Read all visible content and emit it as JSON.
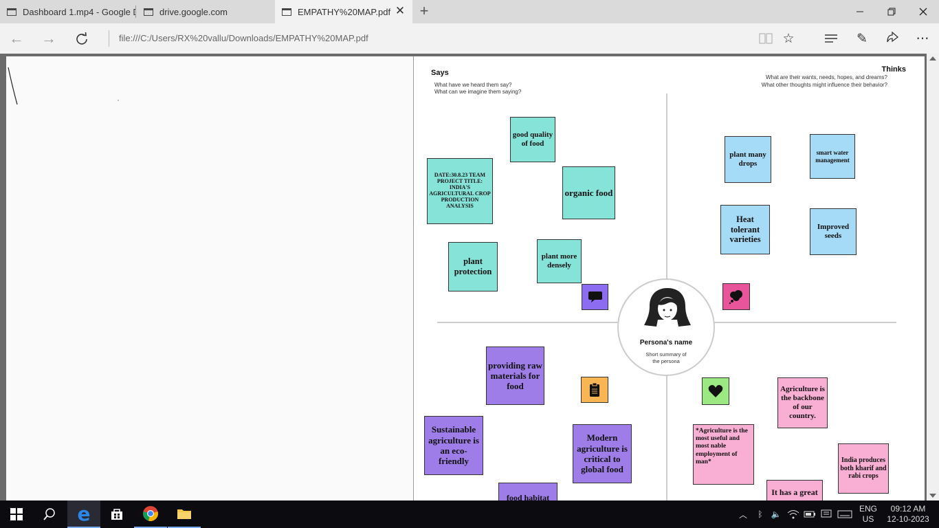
{
  "browser": {
    "tabs": [
      {
        "label": "Dashboard 1.mp4 - Google D",
        "icon": "tab-page-icon"
      },
      {
        "label": "drive.google.com",
        "icon": "tab-page-icon"
      },
      {
        "label": "EMPATHY%20MAP.pdf",
        "icon": "tab-page-icon"
      }
    ],
    "address": "file:///C:/Users/RX%20vallu/Downloads/EMPATHY%20MAP.pdf"
  },
  "empathy_map": {
    "says": {
      "title": "Says",
      "q1": "What have we heard them say?",
      "q2": "What can we imagine them saying?"
    },
    "thinks": {
      "title": "Thinks",
      "q1": "What are their wants, needs, hopes, and dreams?",
      "q2": "What other thoughts might influence their behavior?"
    },
    "persona": {
      "name": "Persona's name",
      "summary_1": "Short summary of",
      "summary_2": "the persona"
    },
    "notes": {
      "date_title": "DATE:30.8.23 TEAM PROJECT TITLE: INDIA'S AGRICULTURAL CROP PRODUCTION ANALYSIS",
      "good_quality": "good quality of food",
      "organic": "organic food",
      "plant_protection": "plant protection",
      "plant_densely": "plant more densely",
      "plant_drops": "plant many drops",
      "smart_water": "smart water management",
      "heat_tolerant": "Heat tolerant varieties",
      "improved_seeds": "Improved seeds",
      "raw_materials": "providing raw materials for food",
      "sustainable": "Sustainable agriculture is an eco-friendly",
      "modern": "Modern agriculture is critical to global food",
      "food_habitat": "food habitat",
      "backbone": "Agriculture is the backbone of our country.",
      "useful_employment": "*Agriculture is the most useful and most nable employment of man*",
      "kharif_rabi": "India produces both kharif and rabi crops",
      "great": "It has a great"
    }
  },
  "taskbar": {
    "lang_1": "ENG",
    "lang_2": "US",
    "time": "09:12 AM",
    "date": "12-10-2023"
  },
  "colors": {
    "says_note": "#86e3d8",
    "thinks_note": "#a5dbf7",
    "does_note": "#9f7de8",
    "feels_note": "#f9aed3",
    "says_icon_bg": "#8c6cf0",
    "thinks_icon_bg": "#e8559a",
    "does_icon_bg": "#f8b553",
    "feels_icon_bg": "#9ce883"
  }
}
